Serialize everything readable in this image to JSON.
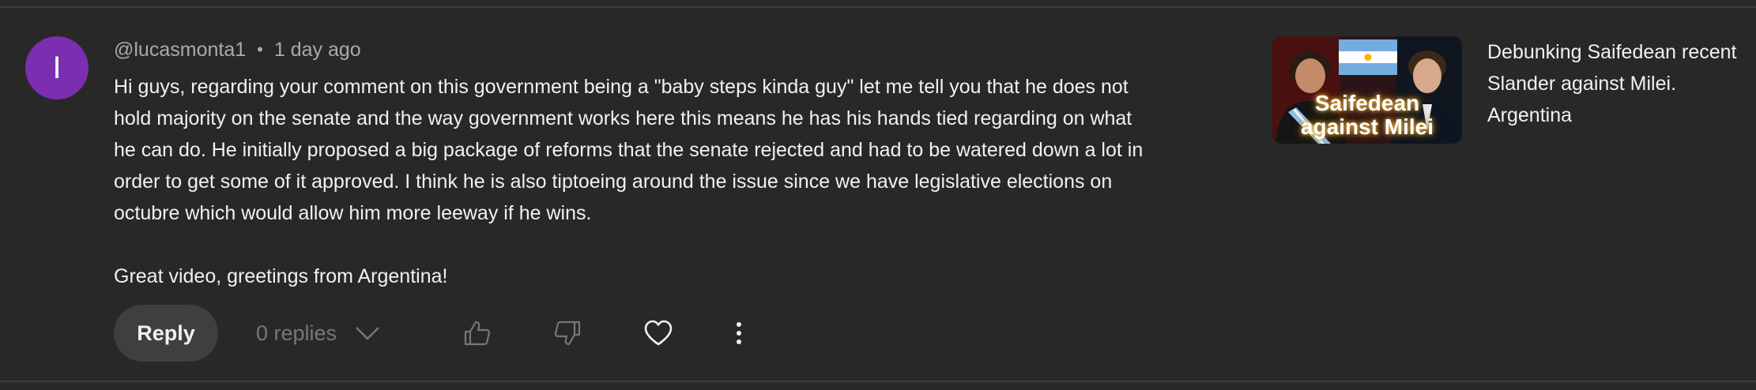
{
  "comment": {
    "avatar_letter": "I",
    "avatar_color": "#7b2fb0",
    "author": "@lucasmonta1",
    "separator": "•",
    "timestamp": "1 day ago",
    "text_paragraph_1": "Hi guys, regarding your comment on this government being a \"baby steps kinda guy\" let me tell you that he does not hold majority on the senate and the way government works here this means he has his hands tied regarding on what he can do. He initially proposed a big package of reforms that the senate rejected and had to be watered down a lot in order to get some of it approved. I think he is also tiptoeing around the issue since we have legislative elections on octubre which would allow him more leeway if he wins.",
    "text_paragraph_2": "Great video, greetings from Argentina!"
  },
  "actions": {
    "reply_label": "Reply",
    "replies_label": "0 replies",
    "icons": [
      "like-icon",
      "dislike-icon",
      "heart-icon",
      "more-icon"
    ]
  },
  "video": {
    "thumbnail_text_line1": "Saifedean",
    "thumbnail_text_line2": "against Milei",
    "title": "Debunking Saifedean recent Slander against Milei. Argentina"
  }
}
